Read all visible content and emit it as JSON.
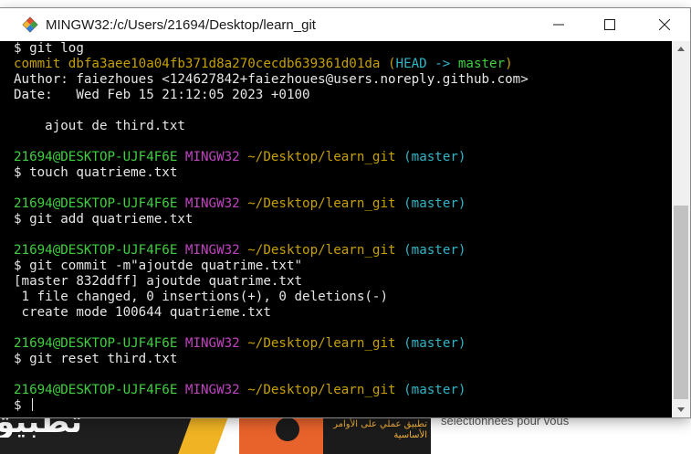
{
  "window": {
    "title": "MINGW32:/c/Users/21694/Desktop/learn_git",
    "icon": "mingw-diamond-icon"
  },
  "colors": {
    "terminal_bg": "#000000",
    "text": "#e6e6e6",
    "yellow": "#c4a000",
    "cyan": "#30b5c6",
    "green": "#3fcf3f",
    "magenta": "#c043c0"
  },
  "terminal": {
    "lines": [
      [
        {
          "t": "$ git log"
        }
      ],
      [
        {
          "t": "commit dbfa3aee10a04fb371d8a270cecdb639361d01da ",
          "c": "yellow"
        },
        {
          "t": "(",
          "c": "yellow"
        },
        {
          "t": "HEAD -> ",
          "c": "cyan"
        },
        {
          "t": "master",
          "c": "green"
        },
        {
          "t": ")",
          "c": "yellow"
        }
      ],
      [
        {
          "t": "Author: faiezhoues <124627842+faiezhoues@users.noreply.github.com>"
        }
      ],
      [
        {
          "t": "Date:   Wed Feb 15 21:12:05 2023 +0100"
        }
      ],
      [
        {
          "t": ""
        }
      ],
      [
        {
          "t": "    ajout de third.txt"
        }
      ],
      [
        {
          "t": ""
        }
      ],
      [
        {
          "t": "21694@DESKTOP-UJF4F6E ",
          "c": "green"
        },
        {
          "t": "MINGW32 ",
          "c": "magenta"
        },
        {
          "t": "~/Desktop/learn_git ",
          "c": "yellow"
        },
        {
          "t": "(master)",
          "c": "cyan"
        }
      ],
      [
        {
          "t": "$ touch quatrieme.txt"
        }
      ],
      [
        {
          "t": ""
        }
      ],
      [
        {
          "t": "21694@DESKTOP-UJF4F6E ",
          "c": "green"
        },
        {
          "t": "MINGW32 ",
          "c": "magenta"
        },
        {
          "t": "~/Desktop/learn_git ",
          "c": "yellow"
        },
        {
          "t": "(master)",
          "c": "cyan"
        }
      ],
      [
        {
          "t": "$ git add quatrieme.txt"
        }
      ],
      [
        {
          "t": ""
        }
      ],
      [
        {
          "t": "21694@DESKTOP-UJF4F6E ",
          "c": "green"
        },
        {
          "t": "MINGW32 ",
          "c": "magenta"
        },
        {
          "t": "~/Desktop/learn_git ",
          "c": "yellow"
        },
        {
          "t": "(master)",
          "c": "cyan"
        }
      ],
      [
        {
          "t": "$ git commit -m\"ajoutde quatrime.txt\""
        }
      ],
      [
        {
          "t": "[master 832ddff] ajoutde quatrime.txt"
        }
      ],
      [
        {
          "t": " 1 file changed, 0 insertions(+), 0 deletions(-)"
        }
      ],
      [
        {
          "t": " create mode 100644 quatrieme.txt"
        }
      ],
      [
        {
          "t": ""
        }
      ],
      [
        {
          "t": "21694@DESKTOP-UJF4F6E ",
          "c": "green"
        },
        {
          "t": "MINGW32 ",
          "c": "magenta"
        },
        {
          "t": "~/Desktop/learn_git ",
          "c": "yellow"
        },
        {
          "t": "(master)",
          "c": "cyan"
        }
      ],
      [
        {
          "t": "$ git reset third.txt"
        }
      ],
      [
        {
          "t": ""
        }
      ],
      [
        {
          "t": "21694@DESKTOP-UJF4F6E ",
          "c": "green"
        },
        {
          "t": "MINGW32 ",
          "c": "magenta"
        },
        {
          "t": "~/Desktop/learn_git ",
          "c": "yellow"
        },
        {
          "t": "(master)",
          "c": "cyan"
        }
      ],
      [
        {
          "t": "$ "
        }
      ]
    ]
  },
  "background": {
    "arabic_large": "تطبيق",
    "arabic_small": "ر",
    "book_title": "تطبيق عملي على الأوامر الأساسية",
    "selection_text": "sélectionnées pour vous"
  }
}
